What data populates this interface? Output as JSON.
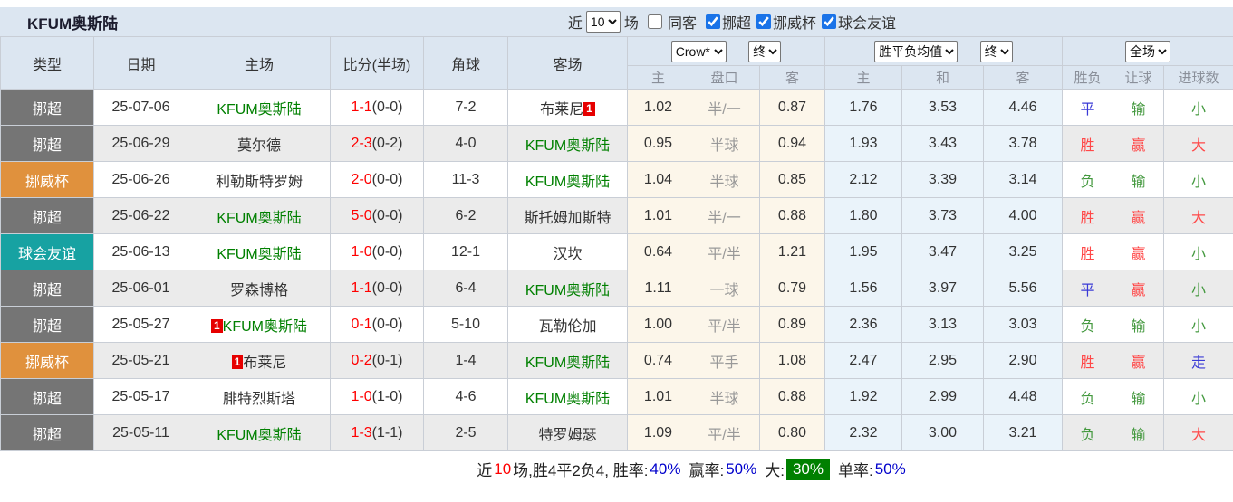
{
  "header": {
    "team_title": "KFUM奥斯陆",
    "near_label": "近",
    "near_value": "10",
    "matches_label": "场",
    "same_venue_label": "同客",
    "same_venue_checked": false,
    "league_filters": [
      {
        "label": "挪超",
        "checked": true
      },
      {
        "label": "挪威杯",
        "checked": true
      },
      {
        "label": "球会友谊",
        "checked": true
      }
    ]
  },
  "table": {
    "columns": {
      "type": "类型",
      "date": "日期",
      "home": "主场",
      "score": "比分(半场)",
      "corners": "角球",
      "away": "客场"
    },
    "dropdowns": {
      "bookmaker": "Crow*",
      "bookmaker_final": "终",
      "avg": "胜平负均值",
      "avg_final": "终",
      "full_match": "全场"
    },
    "sub_headers": {
      "odds_home": "主",
      "odds_handicap": "盘口",
      "odds_away": "客",
      "avg_home": "主",
      "avg_draw": "和",
      "avg_away": "客",
      "wdl": "胜负",
      "handicap": "让球",
      "goals": "进球数"
    }
  },
  "rows": [
    {
      "league": "挪超",
      "league_color": "gray",
      "date": "25-07-06",
      "home": {
        "name": "KFUM奥斯陆",
        "kfum": true,
        "badge": "",
        "badge_pos": ""
      },
      "score": "1-1",
      "half": "(0-0)",
      "corners": "7-2",
      "away": {
        "name": "布莱尼",
        "kfum": false,
        "badge": "1",
        "badge_pos": "after"
      },
      "odds": [
        "1.02",
        "半/一",
        "0.87"
      ],
      "avg": [
        "1.76",
        "3.53",
        "4.46"
      ],
      "results": [
        {
          "text": "平",
          "color": "blue"
        },
        {
          "text": "输",
          "color": "green"
        },
        {
          "text": "小",
          "color": "green"
        }
      ]
    },
    {
      "league": "挪超",
      "league_color": "gray",
      "date": "25-06-29",
      "home": {
        "name": "莫尔德",
        "kfum": false,
        "badge": "",
        "badge_pos": ""
      },
      "score": "2-3",
      "half": "(0-2)",
      "corners": "4-0",
      "away": {
        "name": "KFUM奥斯陆",
        "kfum": true,
        "badge": "",
        "badge_pos": ""
      },
      "odds": [
        "0.95",
        "半球",
        "0.94"
      ],
      "avg": [
        "1.93",
        "3.43",
        "3.78"
      ],
      "results": [
        {
          "text": "胜",
          "color": "red"
        },
        {
          "text": "赢",
          "color": "red"
        },
        {
          "text": "大",
          "color": "red"
        }
      ]
    },
    {
      "league": "挪威杯",
      "league_color": "orange",
      "date": "25-06-26",
      "home": {
        "name": "利勒斯特罗姆",
        "kfum": false,
        "badge": "",
        "badge_pos": ""
      },
      "score": "2-0",
      "half": "(0-0)",
      "corners": "11-3",
      "away": {
        "name": "KFUM奥斯陆",
        "kfum": true,
        "badge": "",
        "badge_pos": ""
      },
      "odds": [
        "1.04",
        "半球",
        "0.85"
      ],
      "avg": [
        "2.12",
        "3.39",
        "3.14"
      ],
      "results": [
        {
          "text": "负",
          "color": "green"
        },
        {
          "text": "输",
          "color": "green"
        },
        {
          "text": "小",
          "color": "green"
        }
      ]
    },
    {
      "league": "挪超",
      "league_color": "gray",
      "date": "25-06-22",
      "home": {
        "name": "KFUM奥斯陆",
        "kfum": true,
        "badge": "",
        "badge_pos": ""
      },
      "score": "5-0",
      "half": "(0-0)",
      "corners": "6-2",
      "away": {
        "name": "斯托姆加斯特",
        "kfum": false,
        "badge": "",
        "badge_pos": ""
      },
      "odds": [
        "1.01",
        "半/一",
        "0.88"
      ],
      "avg": [
        "1.80",
        "3.73",
        "4.00"
      ],
      "results": [
        {
          "text": "胜",
          "color": "red"
        },
        {
          "text": "赢",
          "color": "red"
        },
        {
          "text": "大",
          "color": "red"
        }
      ]
    },
    {
      "league": "球会友谊",
      "league_color": "teal",
      "date": "25-06-13",
      "home": {
        "name": "KFUM奥斯陆",
        "kfum": true,
        "badge": "",
        "badge_pos": ""
      },
      "score": "1-0",
      "half": "(0-0)",
      "corners": "12-1",
      "away": {
        "name": "汉坎",
        "kfum": false,
        "badge": "",
        "badge_pos": ""
      },
      "odds": [
        "0.64",
        "平/半",
        "1.21"
      ],
      "avg": [
        "1.95",
        "3.47",
        "3.25"
      ],
      "results": [
        {
          "text": "胜",
          "color": "red"
        },
        {
          "text": "赢",
          "color": "red"
        },
        {
          "text": "小",
          "color": "green"
        }
      ]
    },
    {
      "league": "挪超",
      "league_color": "gray",
      "date": "25-06-01",
      "home": {
        "name": "罗森博格",
        "kfum": false,
        "badge": "",
        "badge_pos": ""
      },
      "score": "1-1",
      "half": "(0-0)",
      "corners": "6-4",
      "away": {
        "name": "KFUM奥斯陆",
        "kfum": true,
        "badge": "",
        "badge_pos": ""
      },
      "odds": [
        "1.11",
        "一球",
        "0.79"
      ],
      "avg": [
        "1.56",
        "3.97",
        "5.56"
      ],
      "results": [
        {
          "text": "平",
          "color": "blue"
        },
        {
          "text": "赢",
          "color": "red"
        },
        {
          "text": "小",
          "color": "green"
        }
      ]
    },
    {
      "league": "挪超",
      "league_color": "gray",
      "date": "25-05-27",
      "home": {
        "name": "KFUM奥斯陆",
        "kfum": true,
        "badge": "1",
        "badge_pos": "before"
      },
      "score": "0-1",
      "half": "(0-0)",
      "corners": "5-10",
      "away": {
        "name": "瓦勒伦加",
        "kfum": false,
        "badge": "",
        "badge_pos": ""
      },
      "odds": [
        "1.00",
        "平/半",
        "0.89"
      ],
      "avg": [
        "2.36",
        "3.13",
        "3.03"
      ],
      "results": [
        {
          "text": "负",
          "color": "green"
        },
        {
          "text": "输",
          "color": "green"
        },
        {
          "text": "小",
          "color": "green"
        }
      ]
    },
    {
      "league": "挪威杯",
      "league_color": "orange",
      "date": "25-05-21",
      "home": {
        "name": "布莱尼",
        "kfum": false,
        "badge": "1",
        "badge_pos": "before"
      },
      "score": "0-2",
      "half": "(0-1)",
      "corners": "1-4",
      "away": {
        "name": "KFUM奥斯陆",
        "kfum": true,
        "badge": "",
        "badge_pos": ""
      },
      "odds": [
        "0.74",
        "平手",
        "1.08"
      ],
      "avg": [
        "2.47",
        "2.95",
        "2.90"
      ],
      "results": [
        {
          "text": "胜",
          "color": "red"
        },
        {
          "text": "赢",
          "color": "red"
        },
        {
          "text": "走",
          "color": "blue"
        }
      ]
    },
    {
      "league": "挪超",
      "league_color": "gray",
      "date": "25-05-17",
      "home": {
        "name": "腓特烈斯塔",
        "kfum": false,
        "badge": "",
        "badge_pos": ""
      },
      "score": "1-0",
      "half": "(1-0)",
      "corners": "4-6",
      "away": {
        "name": "KFUM奥斯陆",
        "kfum": true,
        "badge": "",
        "badge_pos": ""
      },
      "odds": [
        "1.01",
        "半球",
        "0.88"
      ],
      "avg": [
        "1.92",
        "2.99",
        "4.48"
      ],
      "results": [
        {
          "text": "负",
          "color": "green"
        },
        {
          "text": "输",
          "color": "green"
        },
        {
          "text": "小",
          "color": "green"
        }
      ]
    },
    {
      "league": "挪超",
      "league_color": "gray",
      "date": "25-05-11",
      "home": {
        "name": "KFUM奥斯陆",
        "kfum": true,
        "badge": "",
        "badge_pos": ""
      },
      "score": "1-3",
      "half": "(1-1)",
      "corners": "2-5",
      "away": {
        "name": "特罗姆瑟",
        "kfum": false,
        "badge": "",
        "badge_pos": ""
      },
      "odds": [
        "1.09",
        "平/半",
        "0.80"
      ],
      "avg": [
        "2.32",
        "3.00",
        "3.21"
      ],
      "results": [
        {
          "text": "负",
          "color": "green"
        },
        {
          "text": "输",
          "color": "green"
        },
        {
          "text": "大",
          "color": "red"
        }
      ]
    }
  ],
  "footer": {
    "near": "近",
    "count": "10",
    "record": "场,胜4平2负4, 胜率:",
    "win_rate": "40%",
    "handicap_label": "赢率:",
    "handicap_rate": "50%",
    "big_label": "大:",
    "big_rate": "30%",
    "single_label": "单率:",
    "single_rate": "50%"
  },
  "colors": {
    "header_bg": "#dce6f1",
    "row_alt_bg": "#ebebeb",
    "league_gray": "#757575",
    "league_orange": "#e0913d",
    "league_teal": "#17a2a2",
    "odds_col_bg": "#fcf6ea",
    "avg_col_bg": "#eaf3fa",
    "kfum_green": "#008000",
    "score_red": "#ff0000",
    "win_red": "#ff4848",
    "lose_green": "#44993f",
    "draw_blue": "#3a3ad6",
    "rate_blue": "#0000cc",
    "big_rate_badge_green": "#008000",
    "checkbox_accent": "#1a73e8",
    "badge_red": "#e60000"
  }
}
